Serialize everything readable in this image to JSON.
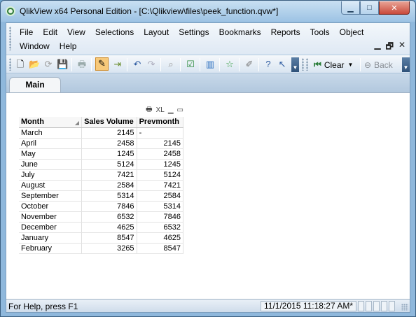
{
  "window": {
    "title": "QlikView x64 Personal Edition - [C:\\Qlikview\\files\\peek_function.qvw*]",
    "minimize_label": "▁",
    "maximize_label": "□",
    "close_label": "✕"
  },
  "menu": {
    "row1": [
      "File",
      "Edit",
      "View",
      "Selections",
      "Layout",
      "Settings",
      "Bookmarks",
      "Reports",
      "Tools",
      "Object"
    ],
    "row2": [
      "Window",
      "Help"
    ],
    "doc_controls": [
      "▁",
      "🗗",
      "✕"
    ]
  },
  "toolbar": {
    "clear_label": "Clear",
    "back_label": "Back"
  },
  "sheet": {
    "tab_label": "Main"
  },
  "table": {
    "caption_xl": "XL",
    "headers": [
      "Month",
      "Sales Volume",
      "Prevmonth"
    ],
    "rows": [
      [
        "March",
        "2145",
        "-"
      ],
      [
        "April",
        "2458",
        "2145"
      ],
      [
        "May",
        "1245",
        "2458"
      ],
      [
        "June",
        "5124",
        "1245"
      ],
      [
        "July",
        "7421",
        "5124"
      ],
      [
        "August",
        "2584",
        "7421"
      ],
      [
        "September",
        "5314",
        "2584"
      ],
      [
        "October",
        "7846",
        "5314"
      ],
      [
        "November",
        "6532",
        "7846"
      ],
      [
        "December",
        "4625",
        "6532"
      ],
      [
        "January",
        "8547",
        "4625"
      ],
      [
        "February",
        "3265",
        "8547"
      ]
    ]
  },
  "status": {
    "help_text": "For Help, press F1",
    "timestamp": "11/1/2015 11:18:27 AM*"
  },
  "colors": {
    "title_bg": "#9dc3e4",
    "close_button": "#c9493a",
    "active_tool": "#f7c97a"
  }
}
